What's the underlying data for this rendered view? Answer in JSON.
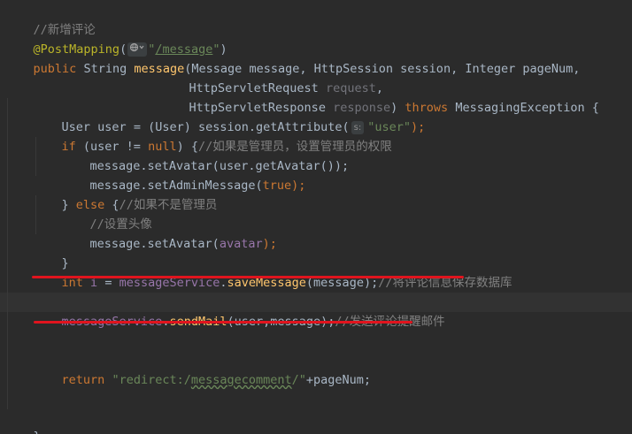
{
  "editor": {
    "colors": {
      "background": "#2b2b2b",
      "keyword": "#cc7832",
      "string": "#6a8759",
      "comment": "#808080",
      "annotation": "#bbb529",
      "method": "#ffc66d",
      "field": "#9876aa",
      "unused_param": "#72737a",
      "annotation_marker": "#e0141e"
    },
    "lines": {
      "l1": {
        "comment": "//新增评论"
      },
      "l2": {
        "annotation": "@PostMapping",
        "open": "(",
        "globe_icon": "globe-icon",
        "path_q1": "\"",
        "path": "/message",
        "path_q2": "\"",
        "close": ")"
      },
      "l3": {
        "kw_public": "public",
        "type_string": "String",
        "method_name": "message",
        "open": "(",
        "type_message": "Message",
        "p1": "message",
        "sep1": ", ",
        "type_session": "HttpSession",
        "p2": "session",
        "sep2": ", ",
        "type_integer": "Integer",
        "p3": "pageNum",
        "sep3": ","
      },
      "l4": {
        "type": "HttpServletRequest",
        "param": "request",
        "sep": ","
      },
      "l5": {
        "type": "HttpServletResponse",
        "param": "response",
        "close": ") ",
        "kw_throws": "throws",
        "exc": "MessagingException",
        "brace": " {"
      },
      "l6": {
        "type": "User",
        "var": "user",
        "assign": " = (",
        "cast": "User",
        "call": ") session.getAttribute(",
        "hint": "s:",
        "str": "\"user\"",
        "end": ");"
      },
      "l7": {
        "kw_if": "if",
        "cond": " (user != ",
        "kw_null": "null",
        "rest": ") {",
        "comment": "//如果是管理员，设置管理员的权限"
      },
      "l8": {
        "code": "message.setAvatar(user.getAvatar());"
      },
      "l9": {
        "code1": "message.setAdminMessage(",
        "kw_true": "true",
        "code2": ");"
      },
      "l10": {
        "brace1": "} ",
        "kw_else": "else",
        "brace2": " {",
        "comment": "//如果不是管理员"
      },
      "l11": {
        "comment": "//设置头像"
      },
      "l12": {
        "code": "message.setAvatar(",
        "param": "avatar",
        "end": ");"
      },
      "l13": {
        "brace": "}"
      },
      "l14": {
        "kw_int": "int",
        "var": "i",
        "assign": " = ",
        "field": "messageService",
        "dot": ".",
        "method": "saveMessage",
        "args": "(message);",
        "comment": "//将评论信息保存数据库"
      },
      "l15": {
        "field": "messageService",
        "dot": ".",
        "method": "sendMail",
        "args": "(user,message);",
        "comment": "//发送评论提醒邮件"
      },
      "l16": {
        "kw_return": "return",
        "space": " ",
        "str_q": "\"redirect:/",
        "str_u": "messagecomment",
        "str_e": "/\"",
        "rest": "+pageNum;"
      },
      "l17": {
        "brace": "}"
      }
    }
  }
}
